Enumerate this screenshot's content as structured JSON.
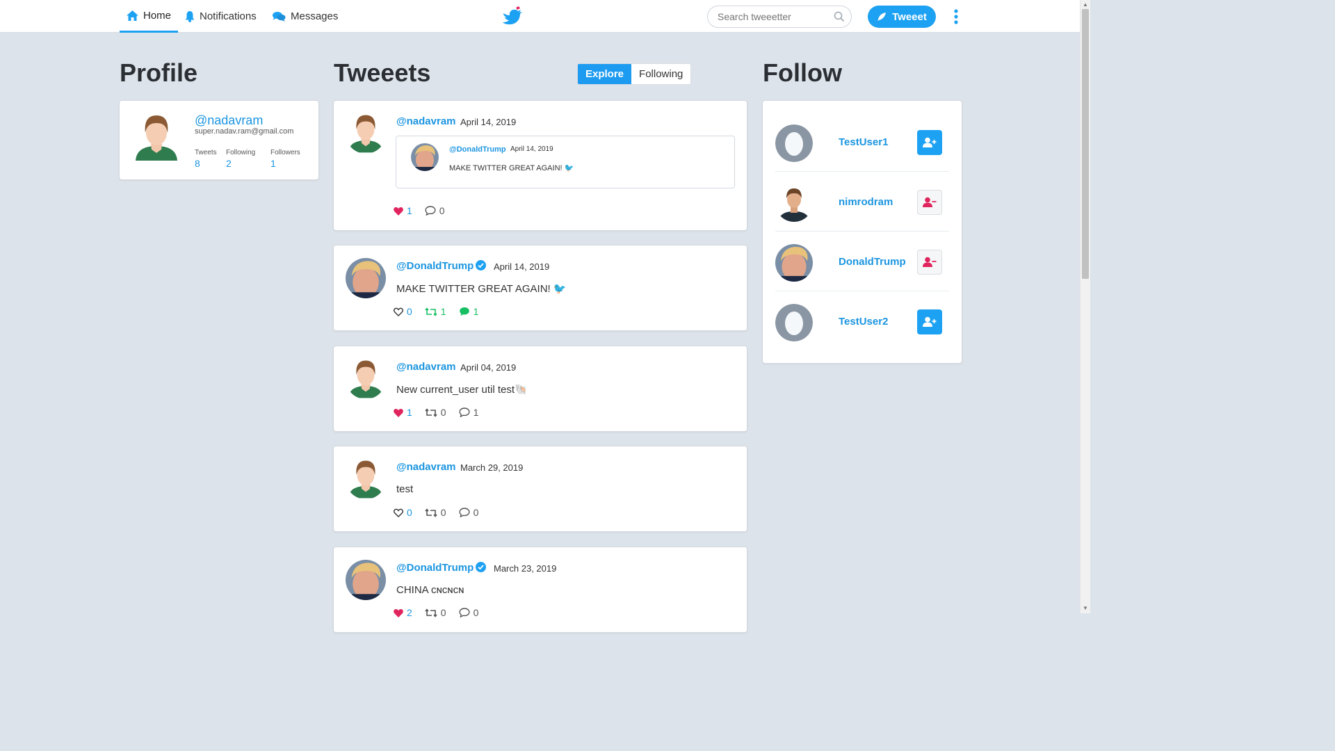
{
  "nav": {
    "home": "Home",
    "notifications": "Notifications",
    "messages": "Messages",
    "search_placeholder": "Search tweeetter",
    "tweet_button": "Tweeet"
  },
  "colors": {
    "accent": "#1da1f2",
    "like": "#e0245e",
    "retweet": "#17bf63"
  },
  "profile": {
    "heading": "Profile",
    "handle": "@nadavram",
    "email": "super.nadav.ram@gmail.com",
    "stats": [
      {
        "label": "Tweets",
        "value": "8"
      },
      {
        "label": "Following",
        "value": "2"
      },
      {
        "label": "Followers",
        "value": "1"
      }
    ]
  },
  "feed": {
    "heading": "Tweeets",
    "tabs": [
      "Explore",
      "Following"
    ],
    "active_tab": "Explore",
    "tweets": [
      {
        "handle": "@nadavram",
        "date": "April 14, 2019",
        "text": "",
        "quote": {
          "handle": "@DonaldTrump",
          "date": "April 14, 2019",
          "text": "MAKE TWITTER GREAT AGAIN! 🐦"
        },
        "likes": "1",
        "liked": true,
        "comments": "0"
      },
      {
        "handle": "@DonaldTrump",
        "verified": true,
        "date": "April 14, 2019",
        "text": "MAKE TWITTER GREAT AGAIN! 🐦",
        "likes": "0",
        "retweets": "1",
        "comments": "1"
      },
      {
        "handle": "@nadavram",
        "date": "April 04, 2019",
        "text": "New current_user util test🐚",
        "likes": "1",
        "liked": true,
        "retweets": "0",
        "comments": "1"
      },
      {
        "handle": "@nadavram",
        "date": "March 29, 2019",
        "text": "test",
        "likes": "0",
        "retweets": "0",
        "comments": "0"
      },
      {
        "handle": "@DonaldTrump",
        "verified": true,
        "date": "March 23, 2019",
        "text": "CHINA ᴄɴᴄɴᴄɴ",
        "likes": "2",
        "liked": true,
        "retweets": "0",
        "comments": "0"
      }
    ]
  },
  "follow": {
    "heading": "Follow",
    "users": [
      {
        "name": "TestUser1",
        "action": "follow"
      },
      {
        "name": "nimrodram",
        "action": "unfollow"
      },
      {
        "name": "DonaldTrump",
        "action": "unfollow"
      },
      {
        "name": "TestUser2",
        "action": "follow"
      }
    ]
  }
}
